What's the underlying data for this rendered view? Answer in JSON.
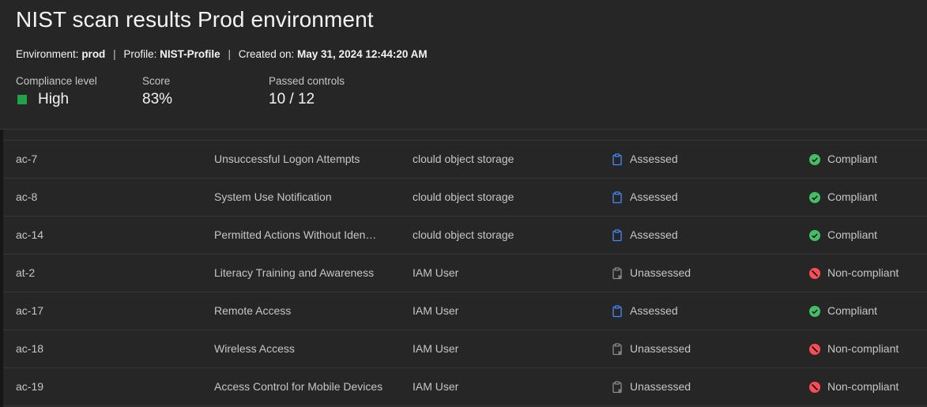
{
  "header": {
    "title": "NIST scan results Prod environment",
    "environment_label": "Environment:",
    "environment_value": "prod",
    "profile_label": "Profile:",
    "profile_value": "NIST-Profile",
    "created_label": "Created on:",
    "created_value": "May 31, 2024 12:44:20 AM",
    "separator": "|",
    "stats": {
      "compliance_label": "Compliance level",
      "compliance_value": "High",
      "compliance_color": "#24a148",
      "score_label": "Score",
      "score_value": "83%",
      "passed_label": "Passed controls",
      "passed_value": "10 / 12"
    }
  },
  "rows": [
    {
      "id": "ac-7",
      "name": "Unsuccessful Logon Attempts",
      "resource": "clould object storage",
      "assessment": "Assessed",
      "assessment_icon": "clipboard-icon",
      "status": "Compliant",
      "status_icon": "checkmark-icon"
    },
    {
      "id": "ac-8",
      "name": "System Use Notification",
      "resource": "clould object storage",
      "assessment": "Assessed",
      "assessment_icon": "clipboard-icon",
      "status": "Compliant",
      "status_icon": "checkmark-icon"
    },
    {
      "id": "ac-14",
      "name": "Permitted Actions Without Iden…",
      "resource": "clould object storage",
      "assessment": "Assessed",
      "assessment_icon": "clipboard-icon",
      "status": "Compliant",
      "status_icon": "checkmark-icon"
    },
    {
      "id": "at-2",
      "name": "Literacy Training and Awareness",
      "resource": "IAM User",
      "assessment": "Unassessed",
      "assessment_icon": "clipboard-x-icon",
      "status": "Non-compliant",
      "status_icon": "misuse-icon"
    },
    {
      "id": "ac-17",
      "name": "Remote Access",
      "resource": "IAM User",
      "assessment": "Assessed",
      "assessment_icon": "clipboard-icon",
      "status": "Compliant",
      "status_icon": "checkmark-icon"
    },
    {
      "id": "ac-18",
      "name": "Wireless Access",
      "resource": "IAM User",
      "assessment": "Unassessed",
      "assessment_icon": "clipboard-x-icon",
      "status": "Non-compliant",
      "status_icon": "misuse-icon"
    },
    {
      "id": "ac-19",
      "name": "Access Control for Mobile Devices",
      "resource": "IAM User",
      "assessment": "Unassessed",
      "assessment_icon": "clipboard-x-icon",
      "status": "Non-compliant",
      "status_icon": "misuse-icon"
    }
  ],
  "colors": {
    "assessed": "#4589ff",
    "unassessed": "#8d8d8d",
    "compliant": "#42be65",
    "noncompliant": "#fa4d56"
  }
}
